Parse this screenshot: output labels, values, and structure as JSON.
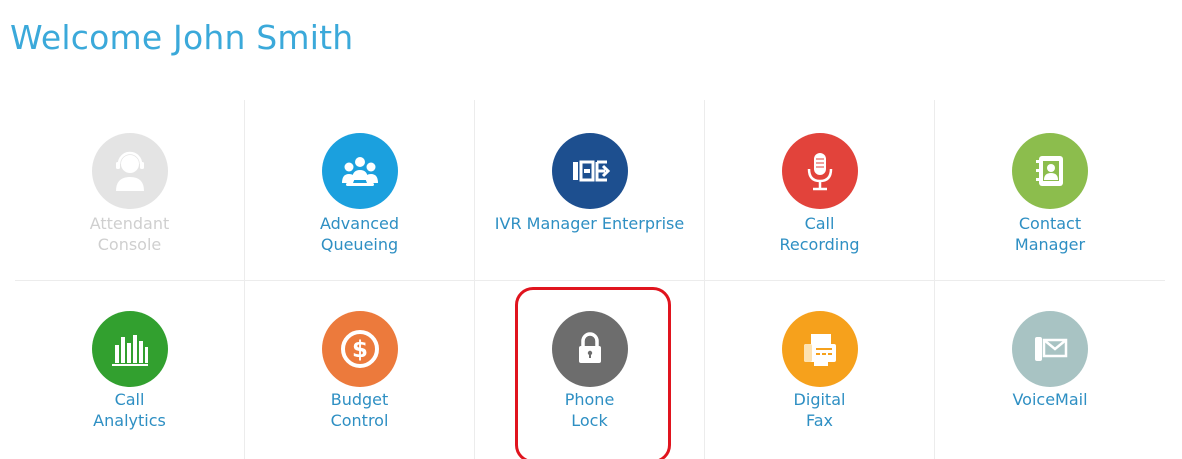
{
  "welcome": {
    "text": "Welcome John Smith"
  },
  "colors": {
    "title": "#3ba9da",
    "label": "#2e8fc3",
    "disabled_label": "#cfcfcf",
    "highlight": "#e0141e"
  },
  "apps": [
    {
      "name": "attendant-console",
      "line1": "Attendant",
      "line2": "Console",
      "icon": "headset-operator-icon",
      "color": "#e4e4e4",
      "enabled": false
    },
    {
      "name": "advanced-queueing",
      "line1": "Advanced",
      "line2": "Queueing",
      "icon": "group-queue-icon",
      "color": "#1ba0de",
      "enabled": true
    },
    {
      "name": "ivr-manager-enterprise",
      "line1": "IVR Manager Enterprise",
      "line2": "",
      "icon": "ivr-icon",
      "color": "#1d4f8f",
      "enabled": true
    },
    {
      "name": "call-recording",
      "line1": "Call",
      "line2": "Recording",
      "icon": "microphone-icon",
      "color": "#e2433b",
      "enabled": true
    },
    {
      "name": "contact-manager",
      "line1": "Contact",
      "line2": "Manager",
      "icon": "contact-card-icon",
      "color": "#8cbd4d",
      "enabled": true
    },
    {
      "name": "call-analytics",
      "line1": "Call",
      "line2": "Analytics",
      "icon": "bar-chart-icon",
      "color": "#32a02f",
      "enabled": true
    },
    {
      "name": "budget-control",
      "line1": "Budget",
      "line2": "Control",
      "icon": "dollar-coin-icon",
      "color": "#ec7a3c",
      "enabled": true
    },
    {
      "name": "phone-lock",
      "line1": "Phone",
      "line2": "Lock",
      "icon": "padlock-icon",
      "color": "#6d6d6d",
      "enabled": true
    },
    {
      "name": "digital-fax",
      "line1": "Digital",
      "line2": "Fax",
      "icon": "fax-machine-icon",
      "color": "#f6a11c",
      "enabled": true
    },
    {
      "name": "voicemail",
      "line1": "VoiceMail",
      "line2": "",
      "icon": "voicemail-envelope-icon",
      "color": "#a8c3c3",
      "enabled": true
    }
  ]
}
